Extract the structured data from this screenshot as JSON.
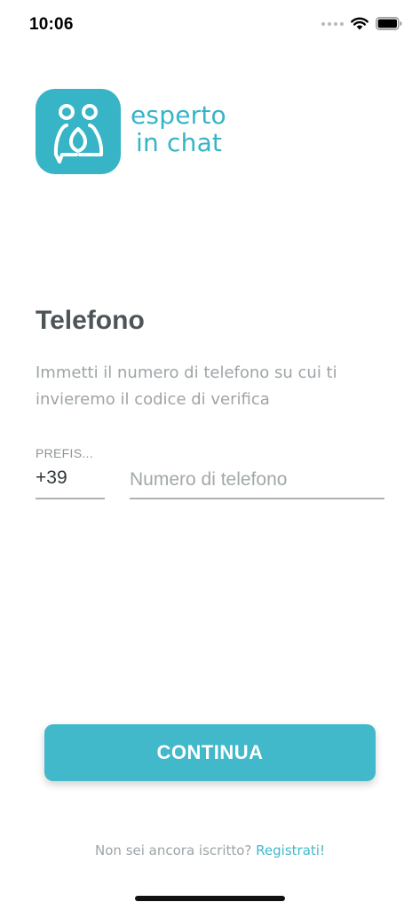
{
  "status_bar": {
    "time": "10:06",
    "icons": [
      "cellular-dots-icon",
      "wifi-icon",
      "battery-icon"
    ]
  },
  "logo": {
    "icon": "two-people-chat-icon",
    "line1": "esperto",
    "line2": "in chat",
    "color": "#37b4c6"
  },
  "heading": {
    "title": "Telefono",
    "description": "Immetti il numero di telefono su cui ti invieremo il codice di verifica"
  },
  "phone_form": {
    "prefix_label": "PREFIS...",
    "prefix_value": "+39",
    "number_placeholder": "Numero di telefono"
  },
  "actions": {
    "continue_label": "CONTINUA",
    "accent_color": "#41b9cb"
  },
  "footer": {
    "prompt": "Non sei ancora iscritto?",
    "signup_link": "Registrati!"
  }
}
